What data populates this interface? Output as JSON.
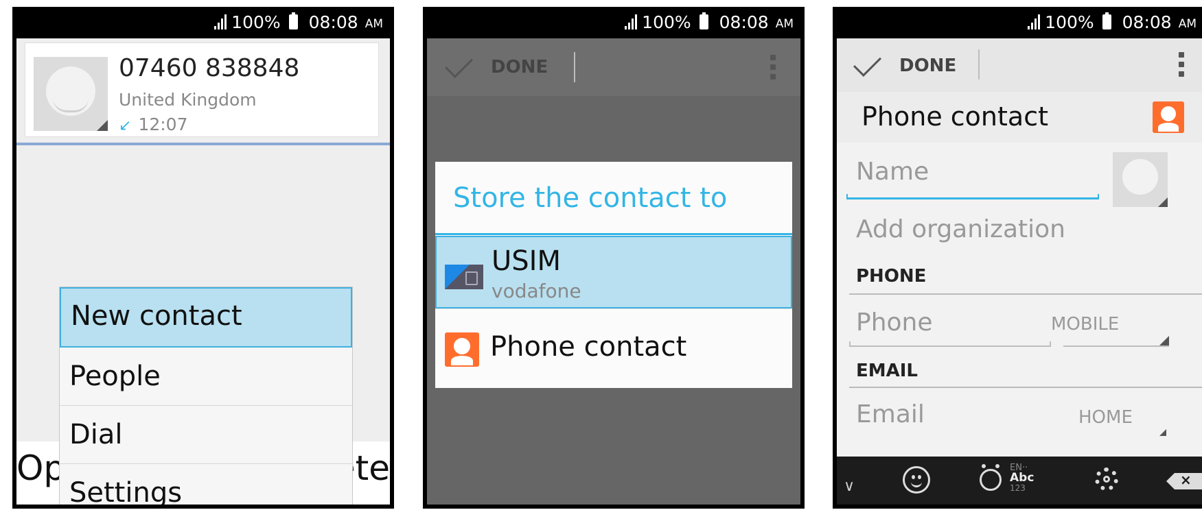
{
  "status_bar": {
    "battery": "100%",
    "time": "08:08",
    "ampm": "AM"
  },
  "panel1": {
    "call": {
      "number": "07460 838848",
      "country": "United Kingdom",
      "time": "12:07",
      "arrow": "↙"
    },
    "bottom_left": "Op",
    "bottom_right": "ete",
    "menu": [
      {
        "label": "New contact",
        "selected": true
      },
      {
        "label": "People"
      },
      {
        "label": "Dial"
      },
      {
        "label": "Settings"
      }
    ]
  },
  "panel2": {
    "done_label": "DONE",
    "dialog_title": "Store the contact to",
    "options": [
      {
        "label": "USIM",
        "sub": "vodafone",
        "icon": "sim-card-icon"
      },
      {
        "label": "Phone contact",
        "icon": "phone-contact-icon"
      }
    ]
  },
  "panel3": {
    "done_label": "DONE",
    "account": "Phone contact",
    "name_placeholder": "Name",
    "org_placeholder": "Add organization",
    "phone_header": "PHONE",
    "phone_placeholder": "Phone",
    "phone_type": "MOBILE",
    "email_header": "EMAIL",
    "email_placeholder": "Email",
    "email_type": "HOME",
    "keyboard": {
      "lang": "EN··",
      "abc": "Abc",
      "num": "123",
      "hide": "∨",
      "del": "×"
    }
  },
  "colors": {
    "accent": "#33b5e5",
    "selection": "#b8e0f0",
    "contact_orange": "#ff6d2d"
  }
}
